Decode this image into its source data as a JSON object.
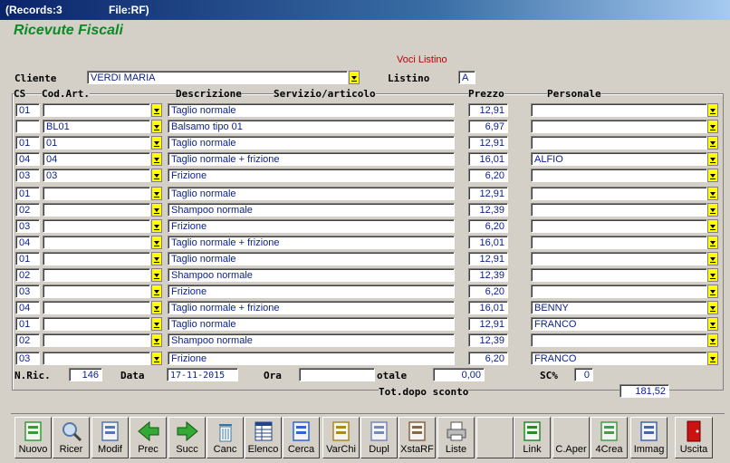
{
  "window": {
    "records": "(Records:3",
    "file": "File:RF)"
  },
  "app_title": "Ricevute Fiscali",
  "voci_listino": "Voci Listino",
  "cliente": {
    "label": "Cliente",
    "value": "VERDI MARIA"
  },
  "listino": {
    "label": "Listino",
    "value": "A"
  },
  "headers": {
    "cs": "CS",
    "cod_art": "Cod.Art.",
    "descrizione": "Descrizione",
    "servizio": "Servizio/articolo",
    "prezzo": "Prezzo",
    "personale": "Personale"
  },
  "rows": [
    {
      "cs": "01",
      "cod": "",
      "desc": "Taglio normale",
      "prezzo": "12,91",
      "pers": ""
    },
    {
      "cs": "",
      "cod": "BL01",
      "desc": "Balsamo tipo 01",
      "prezzo": "6,97",
      "pers": ""
    },
    {
      "cs": "01",
      "cod": "01",
      "desc": "Taglio normale",
      "prezzo": "12,91",
      "pers": ""
    },
    {
      "cs": "04",
      "cod": "04",
      "desc": "Taglio normale + frizione",
      "prezzo": "16,01",
      "pers": "ALFIO"
    },
    {
      "cs": "03",
      "cod": "03",
      "desc": "Frizione",
      "prezzo": "6,20",
      "pers": ""
    },
    {
      "cs": "01",
      "cod": "",
      "desc": "Taglio normale",
      "prezzo": "12,91",
      "pers": ""
    },
    {
      "cs": "02",
      "cod": "",
      "desc": "Shampoo normale",
      "prezzo": "12,39",
      "pers": ""
    },
    {
      "cs": "03",
      "cod": "",
      "desc": "Frizione",
      "prezzo": "6,20",
      "pers": ""
    },
    {
      "cs": "04",
      "cod": "",
      "desc": "Taglio normale + frizione",
      "prezzo": "16,01",
      "pers": ""
    },
    {
      "cs": "01",
      "cod": "",
      "desc": "Taglio normale",
      "prezzo": "12,91",
      "pers": ""
    },
    {
      "cs": "02",
      "cod": "",
      "desc": "Shampoo normale",
      "prezzo": "12,39",
      "pers": ""
    },
    {
      "cs": "03",
      "cod": "",
      "desc": "Frizione",
      "prezzo": "6,20",
      "pers": ""
    },
    {
      "cs": "04",
      "cod": "",
      "desc": "Taglio normale + frizione",
      "prezzo": "16,01",
      "pers": "BENNY"
    },
    {
      "cs": "01",
      "cod": "",
      "desc": "Taglio normale",
      "prezzo": "12,91",
      "pers": "FRANCO"
    },
    {
      "cs": "02",
      "cod": "",
      "desc": "Shampoo normale",
      "prezzo": "12,39",
      "pers": ""
    },
    {
      "cs": "03",
      "cod": "",
      "desc": "Frizione",
      "prezzo": "6,20",
      "pers": "FRANCO"
    }
  ],
  "footer": {
    "nric_label": "N.Ric.",
    "nric": "146",
    "data_label": "Data",
    "data": "17-11-2015",
    "ora_label": "Ora",
    "ora": "",
    "totale_label": "otale",
    "totale": "0,00",
    "sc_label": "SC%",
    "sc": "0",
    "totsconto_label": "Tot.dopo sconto",
    "totsconto": "181,52"
  },
  "toolbar": [
    {
      "name": "nuovo",
      "label": "Nuovo",
      "icon": "new-doc-icon"
    },
    {
      "name": "ricer",
      "label": "Ricer",
      "icon": "magnifier-icon"
    },
    {
      "name": "modif",
      "label": "Modif",
      "icon": "edit-icon"
    },
    {
      "name": "prec",
      "label": "Prec",
      "icon": "arrow-left-icon"
    },
    {
      "name": "succ",
      "label": "Succ",
      "icon": "arrow-right-icon"
    },
    {
      "name": "canc",
      "label": "Canc",
      "icon": "trash-icon"
    },
    {
      "name": "elenco",
      "label": "Elenco",
      "icon": "table-icon"
    },
    {
      "name": "cerca",
      "label": "Cerca",
      "icon": "flashlight-icon"
    },
    {
      "name": "varchi",
      "label": "VarChi",
      "icon": "keys-icon"
    },
    {
      "name": "dupl",
      "label": "Dupl",
      "icon": "duplicate-icon"
    },
    {
      "name": "xstarf",
      "label": "XstaRF",
      "icon": "print-preview-icon"
    },
    {
      "name": "liste",
      "label": "Liste",
      "icon": "printer-icon"
    },
    {
      "name": "blank",
      "label": "",
      "icon": ""
    },
    {
      "name": "link",
      "label": "Link",
      "icon": "network-icon"
    },
    {
      "name": "caper",
      "label": "C.Aper",
      "icon": ""
    },
    {
      "name": "4crea",
      "label": "4Crea",
      "icon": "picture-icon"
    },
    {
      "name": "immag",
      "label": "Immag",
      "icon": "id-card-icon"
    },
    {
      "name": "uscita",
      "label": "Uscita",
      "icon": "exit-door-icon"
    }
  ]
}
